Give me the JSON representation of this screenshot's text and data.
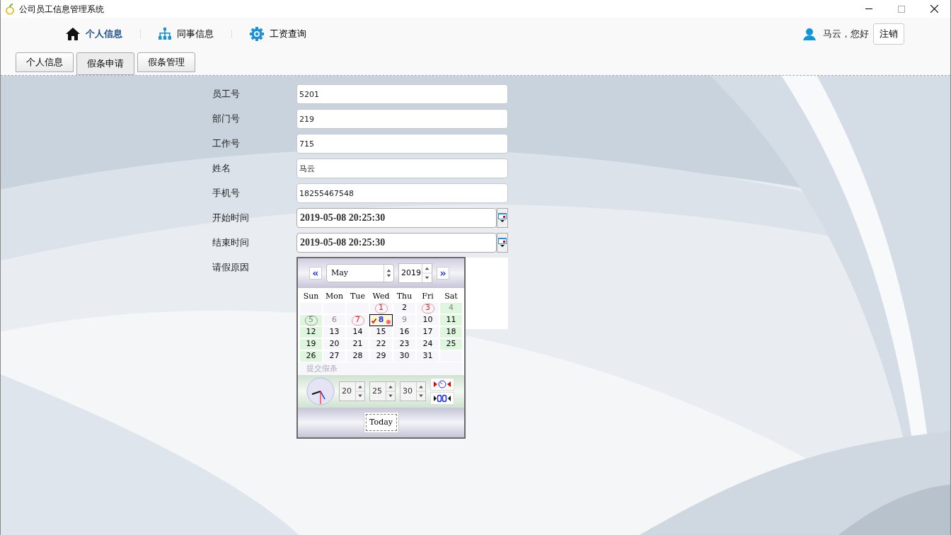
{
  "window": {
    "title": "公司员工信息管理系统"
  },
  "nav": [
    {
      "label": "个人信息",
      "selected": true
    },
    {
      "label": "同事信息",
      "selected": false
    },
    {
      "label": "工资查询",
      "selected": false
    }
  ],
  "user": {
    "greeting": "马云，您好",
    "logout": "注销"
  },
  "tabs": [
    {
      "label": "个人信息",
      "selected": false
    },
    {
      "label": "假条申请",
      "selected": true
    },
    {
      "label": "假条管理",
      "selected": false
    }
  ],
  "form": [
    {
      "label": "员工号",
      "kind": "text",
      "value": "5201"
    },
    {
      "label": "部门号",
      "kind": "text",
      "value": "219"
    },
    {
      "label": "工作号",
      "kind": "text",
      "value": "715"
    },
    {
      "label": "姓名",
      "kind": "text",
      "value": "马云"
    },
    {
      "label": "手机号",
      "kind": "text",
      "value": "18255467548"
    },
    {
      "label": "开始时间",
      "kind": "date",
      "value": "2019-05-08 20:25:30"
    },
    {
      "label": "结束时间",
      "kind": "date",
      "value": "2019-05-08 20:25:30"
    },
    {
      "label": "请假原因",
      "kind": "textarea"
    }
  ],
  "calendar": {
    "prev": "«",
    "month": "May",
    "year": "2019",
    "next": "»",
    "weekdays": [
      "Sun",
      "Mon",
      "Tue",
      "Wed",
      "Thu",
      "Fri",
      "Sat"
    ],
    "weeks": [
      [
        {
          "day": "1",
          "circled": true,
          "holiday": true,
          "muted": false,
          "weekend": false,
          "selected": false
        },
        {
          "day": "2",
          "circled": false,
          "holiday": false,
          "muted": false,
          "weekend": false,
          "selected": false
        },
        {
          "day": "3",
          "circled": true,
          "holiday": true,
          "muted": false,
          "weekend": false,
          "selected": false
        },
        {
          "day": "4",
          "circled": false,
          "holiday": false,
          "muted": true,
          "weekend": true,
          "selected": false
        }
      ],
      [
        {
          "day": "5",
          "circled": true,
          "holiday": false,
          "muted": true,
          "weekend": true,
          "selected": false
        },
        {
          "day": "6",
          "circled": false,
          "holiday": false,
          "muted": true,
          "weekend": false,
          "selected": false
        },
        {
          "day": "7",
          "circled": true,
          "holiday": true,
          "muted": false,
          "weekend": false,
          "selected": false
        },
        {
          "day": "8",
          "circled": false,
          "holiday": false,
          "muted": false,
          "weekend": false,
          "selected": true
        },
        {
          "day": "9",
          "circled": false,
          "holiday": false,
          "muted": true,
          "weekend": false,
          "selected": false
        },
        {
          "day": "10",
          "circled": false,
          "holiday": false,
          "muted": false,
          "weekend": false,
          "selected": false
        },
        {
          "day": "11",
          "circled": false,
          "holiday": false,
          "muted": false,
          "weekend": true,
          "selected": false
        }
      ],
      [
        {
          "day": "12",
          "circled": false,
          "holiday": false,
          "muted": false,
          "weekend": true,
          "selected": false
        },
        {
          "day": "13",
          "circled": false,
          "holiday": false,
          "muted": false,
          "weekend": false,
          "selected": false
        },
        {
          "day": "14",
          "circled": false,
          "holiday": false,
          "muted": false,
          "weekend": false,
          "selected": false
        },
        {
          "day": "15",
          "circled": false,
          "holiday": false,
          "muted": false,
          "weekend": false,
          "selected": false
        },
        {
          "day": "16",
          "circled": false,
          "holiday": false,
          "muted": false,
          "weekend": false,
          "selected": false
        },
        {
          "day": "17",
          "circled": false,
          "holiday": false,
          "muted": false,
          "weekend": false,
          "selected": false
        },
        {
          "day": "18",
          "circled": false,
          "holiday": false,
          "muted": false,
          "weekend": true,
          "selected": false
        }
      ],
      [
        {
          "day": "19",
          "circled": false,
          "holiday": false,
          "muted": false,
          "weekend": true,
          "selected": false
        },
        {
          "day": "20",
          "circled": false,
          "holiday": false,
          "muted": false,
          "weekend": false,
          "selected": false
        },
        {
          "day": "21",
          "circled": false,
          "holiday": false,
          "muted": false,
          "weekend": false,
          "selected": false
        },
        {
          "day": "22",
          "circled": false,
          "holiday": false,
          "muted": false,
          "weekend": false,
          "selected": false
        },
        {
          "day": "23",
          "circled": false,
          "holiday": false,
          "muted": false,
          "weekend": false,
          "selected": false
        },
        {
          "day": "24",
          "circled": false,
          "holiday": false,
          "muted": false,
          "weekend": false,
          "selected": false
        },
        {
          "day": "25",
          "circled": false,
          "holiday": false,
          "muted": false,
          "weekend": true,
          "selected": false
        }
      ],
      [
        {
          "day": "26",
          "circled": false,
          "holiday": false,
          "muted": false,
          "weekend": true,
          "selected": false
        },
        {
          "day": "27",
          "circled": false,
          "holiday": false,
          "muted": false,
          "weekend": false,
          "selected": false
        },
        {
          "day": "28",
          "circled": false,
          "holiday": false,
          "muted": false,
          "weekend": false,
          "selected": false
        },
        {
          "day": "29",
          "circled": false,
          "holiday": false,
          "muted": false,
          "weekend": false,
          "selected": false
        },
        {
          "day": "30",
          "circled": false,
          "holiday": false,
          "muted": false,
          "weekend": false,
          "selected": false
        },
        {
          "day": "31",
          "circled": false,
          "holiday": false,
          "muted": false,
          "weekend": false,
          "selected": false
        }
      ]
    ],
    "behind_text": "提交假条",
    "hour": "20",
    "minute": "25",
    "second": "30",
    "today": "Today"
  }
}
